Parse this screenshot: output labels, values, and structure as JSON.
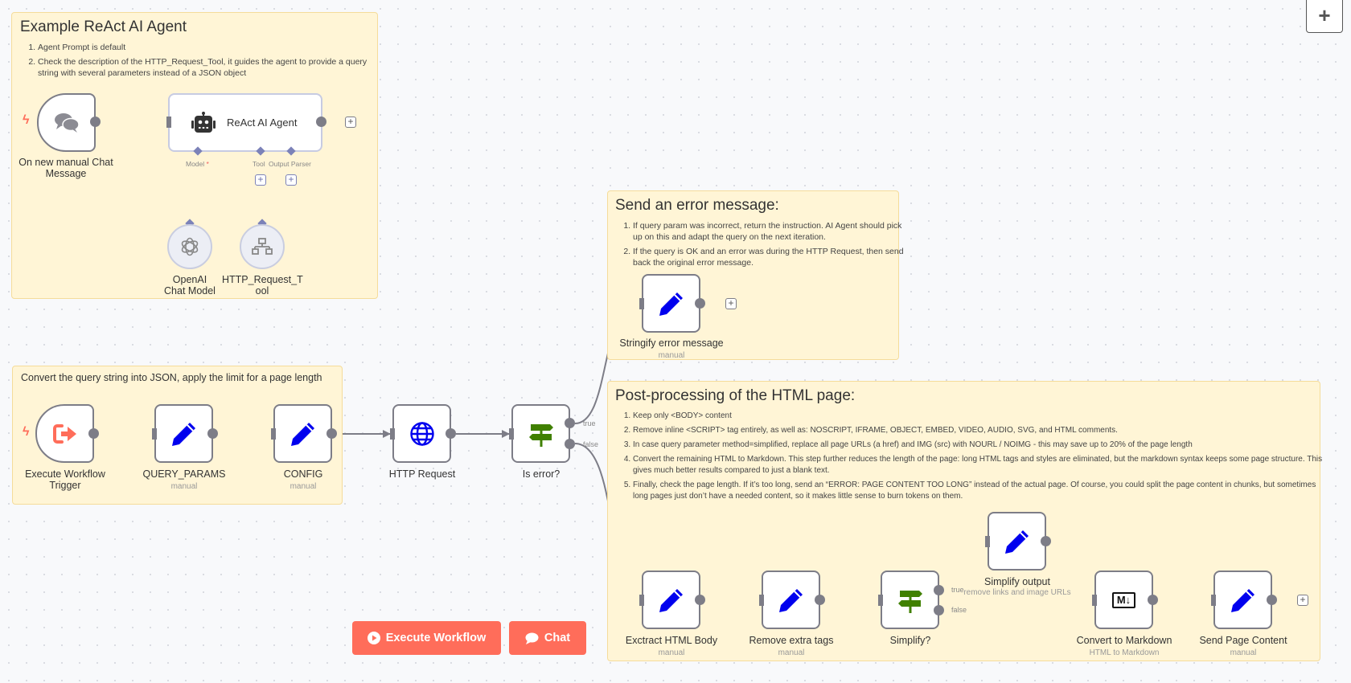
{
  "canvas": {
    "zoom_in_label": "+"
  },
  "stickies": {
    "react": {
      "title": "Example ReAct AI Agent",
      "items": [
        "Agent Prompt is default",
        "Check the description of the HTTP_Request_Tool, it guides the agent to provide a query string with several parameters instead of a JSON object"
      ]
    },
    "convert": {
      "title": "Convert the query string into JSON, apply the limit for a page length"
    },
    "error": {
      "title": "Send an error message:",
      "items": [
        "If query param was incorrect, return the instruction. AI Agent should pick up on this and adapt the query on the next iteration.",
        "If the query is OK and an error was during the HTTP Request, then send back the original error message."
      ]
    },
    "post": {
      "title": "Post-processing of the HTML page:",
      "items": [
        "Keep only <BODY> content",
        "Remove inline <SCRIPT> tag entirely, as well as: NOSCRIPT, IFRAME, OBJECT, EMBED, VIDEO, AUDIO, SVG, and HTML comments.",
        "In case query parameter method=simplified, replace all page URLs (a href) and IMG (src) with NOURL / NOIMG - this may save up to 20% of the page length",
        "Convert the remaining HTML to Markdown. This step further reduces the length of the page: long HTML tags and styles are eliminated, but the markdown syntax keeps some page structure. This gives much better results compared to just a blank text.",
        "Finally, check the page length. If it’s too long, send an “ERROR: PAGE CONTENT TOO LONG” instead of the actual page. Of course, you could split the page content in chunks, but sometimes long pages just don’t have a needed content, so it makes little sense to burn tokens on them."
      ]
    }
  },
  "agent_section": {
    "chat_trigger": {
      "label": "On new manual Chat Message",
      "icon": "chat-bubbles-icon"
    },
    "agent": {
      "label": "ReAct AI Agent",
      "icon": "robot-icon"
    },
    "ports": {
      "model": "Model",
      "model_required": "*",
      "tool": "Tool",
      "output_parser": "Output Parser"
    },
    "openai": {
      "label": "OpenAI Chat Model",
      "icon": "openai-icon"
    },
    "http_tool": {
      "label": "HTTP_Request_Tool",
      "label_line1": "HTTP_Request_T",
      "label_line2": "ool",
      "icon": "network-icon"
    }
  },
  "nodes": {
    "exec_trigger": {
      "label_line1": "Execute Workflow",
      "label_line2": "Trigger",
      "icon": "sign-out-icon"
    },
    "query_params": {
      "label": "QUERY_PARAMS",
      "sub": "manual",
      "icon": "pencil-icon"
    },
    "config": {
      "label": "CONFIG",
      "sub": "manual",
      "icon": "pencil-icon"
    },
    "http_request": {
      "label": "HTTP Request",
      "icon": "globe-icon"
    },
    "is_error": {
      "label": "Is error?",
      "icon": "signpost-icon",
      "true_label": "true",
      "false_label": "false"
    },
    "stringify": {
      "label": "Stringify error message",
      "sub": "manual",
      "icon": "pencil-icon"
    },
    "extract_body": {
      "label": "Exctract HTML Body",
      "sub": "manual",
      "icon": "pencil-icon"
    },
    "remove_tags": {
      "label": "Remove extra tags",
      "sub": "manual",
      "icon": "pencil-icon"
    },
    "simplify_q": {
      "label": "Simplify?",
      "icon": "signpost-icon",
      "true_label": "true",
      "false_label": "false"
    },
    "simplify_output": {
      "label": "Simplify output",
      "sub": "remove links and image URLs",
      "icon": "pencil-icon"
    },
    "convert_md": {
      "label": "Convert to Markdown",
      "sub": "HTML to Markdown",
      "icon": "markdown-icon",
      "icon_text": "M↓"
    },
    "send_page": {
      "label": "Send Page Content",
      "sub": "manual",
      "icon": "pencil-icon"
    }
  },
  "buttons": {
    "execute": "Execute Workflow",
    "chat": "Chat"
  },
  "colors": {
    "accent": "#ff6d5a",
    "sticky_bg": "#fff5d6",
    "edit_icon": "#0000ee",
    "if_icon": "#408000",
    "connector": "#7d7d87",
    "sub_connector": "#7c82b8"
  }
}
